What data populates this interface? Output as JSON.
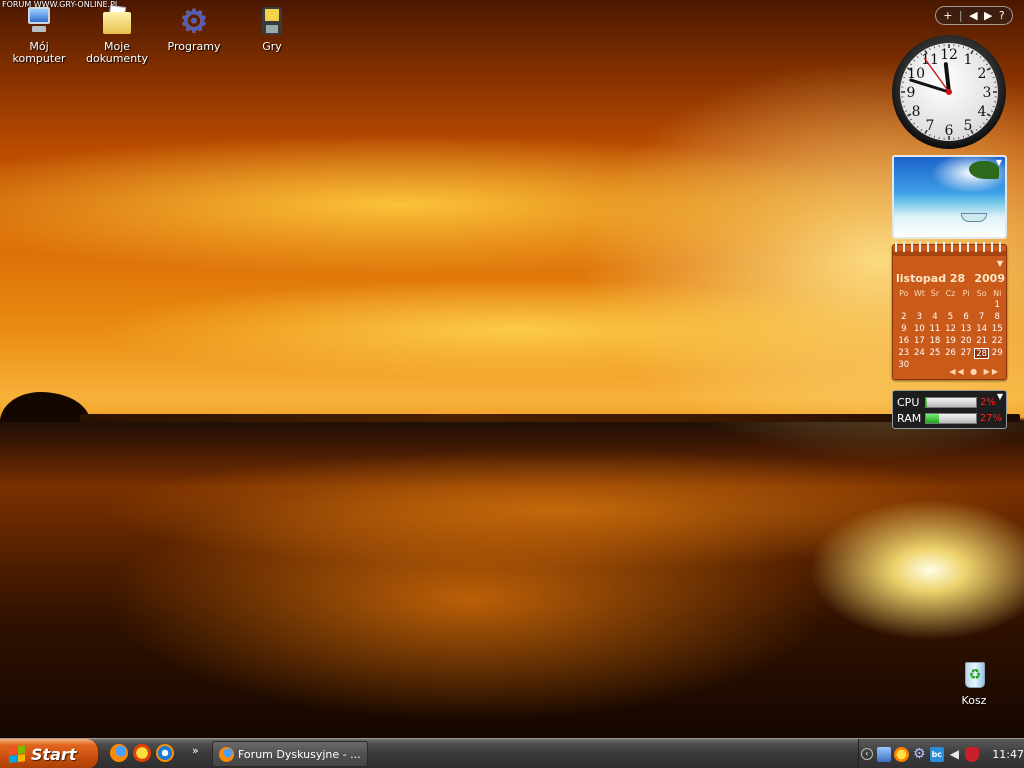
{
  "watermark": "FORUM WWW.GRY-ONLINE.PL",
  "desktop_icons": [
    {
      "label": "Mój komputer",
      "icon": "computer-icon"
    },
    {
      "label": "Moje dokumenty",
      "icon": "documents-folder-icon"
    },
    {
      "label": "Programy",
      "icon": "gear-icon"
    },
    {
      "label": "Gry",
      "icon": "floppy-icon"
    }
  ],
  "recycle_bin": {
    "label": "Kosz",
    "icon": "recycle-bin-icon"
  },
  "gadget_toolbar": {
    "add": "+",
    "prev": "◀",
    "next": "▶",
    "help": "?"
  },
  "clock_gadget": {
    "hour": 11,
    "minute": 47,
    "second": 54,
    "numerals": [
      "12",
      "1",
      "2",
      "3",
      "4",
      "5",
      "6",
      "7",
      "8",
      "9",
      "10",
      "11"
    ]
  },
  "slideshow_gadget": {
    "icon": "beach-photo"
  },
  "calendar_gadget": {
    "month_day": "listopad 28",
    "year": "2009",
    "weekdays": [
      "Po",
      "Wt",
      "Śr",
      "Cz",
      "Pi",
      "So",
      "Ni"
    ],
    "weeks": [
      [
        "",
        "",
        "",
        "",
        "",
        "",
        "1"
      ],
      [
        "2",
        "3",
        "4",
        "5",
        "6",
        "7",
        "8"
      ],
      [
        "9",
        "10",
        "11",
        "12",
        "13",
        "14",
        "15"
      ],
      [
        "16",
        "17",
        "18",
        "19",
        "20",
        "21",
        "22"
      ],
      [
        "23",
        "24",
        "25",
        "26",
        "27",
        "28",
        "29"
      ],
      [
        "30",
        "",
        "",
        "",
        "",
        "",
        ""
      ]
    ],
    "today": "28",
    "nav": "◀◀ ● ▶▶"
  },
  "cpu_meter": {
    "cpu_label": "CPU",
    "cpu_value": "2%",
    "cpu_fraction": 0.02,
    "ram_label": "RAM",
    "ram_value": "27%",
    "ram_fraction": 0.27
  },
  "taskbar": {
    "start_label": "Start",
    "quick_launch": [
      "firefox-icon",
      "messenger-icon",
      "media-player-icon"
    ],
    "more": "»",
    "task_button_label": "Forum Dyskusyjne - ...",
    "tray_icons": [
      "network-icon",
      "sun-icon",
      "gear-icon",
      "bc-icon",
      "volume-icon",
      "shield-icon"
    ],
    "tray_bc": "bc",
    "time": "11:47"
  }
}
